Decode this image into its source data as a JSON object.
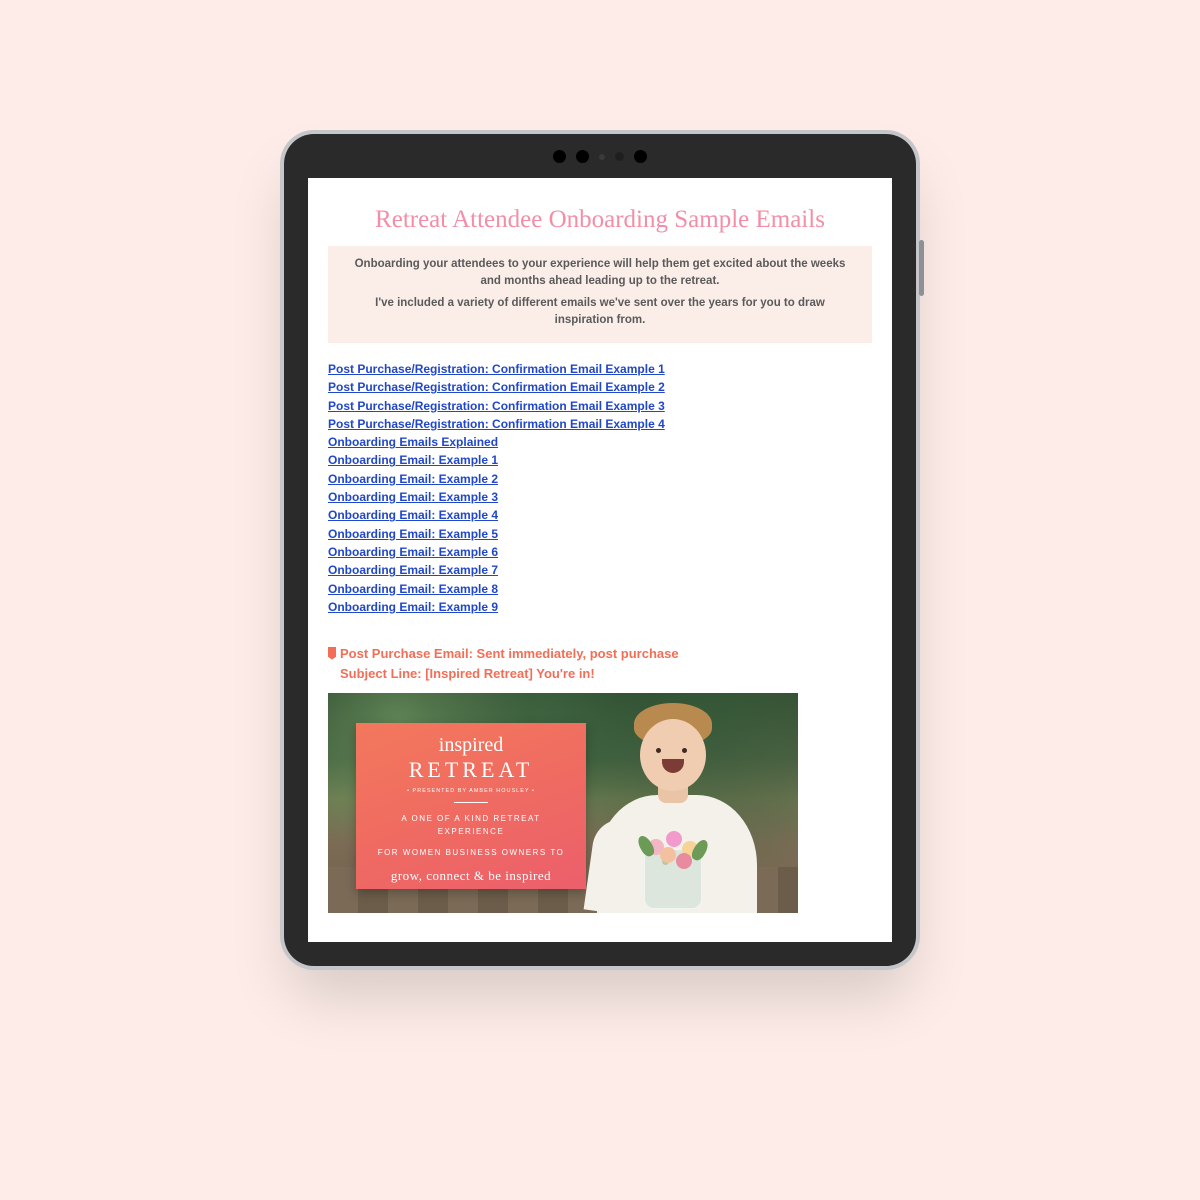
{
  "doc": {
    "title": "Retreat Attendee Onboarding Sample Emails",
    "intro_p1": "Onboarding your attendees to your experience will help them get excited about the weeks and months ahead leading up to the retreat.",
    "intro_p2": "I've included a variety of different emails we've sent over the years for you to draw inspiration from.",
    "toc": [
      "Post Purchase/Registration: Confirmation Email Example 1",
      "Post Purchase/Registration: Confirmation Email Example 2",
      "Post Purchase/Registration: Confirmation Email Example 3",
      "Post Purchase/Registration: Confirmation Email Example 4",
      "Onboarding Emails Explained",
      "Onboarding Email: Example 1",
      "Onboarding Email: Example 2",
      "Onboarding Email: Example 3",
      "Onboarding Email: Example 4",
      "Onboarding Email: Example 5",
      "Onboarding Email: Example 6",
      "Onboarding Email: Example 7",
      "Onboarding Email: Example 8",
      "Onboarding Email: Example 9"
    ],
    "section_heading": "Post Purchase Email: Sent immediately, post purchase",
    "subject_line": "Subject Line: [Inspired Retreat] You're in!"
  },
  "hero": {
    "script": "inspired",
    "retreat": "RETREAT",
    "presented": "• PRESENTED BY AMBER HOUSLEY •",
    "tag1": "A ONE OF A KIND RETREAT EXPERIENCE",
    "tag2": "FOR WOMEN BUSINESS OWNERS TO",
    "tag3": "grow, connect & be inspired"
  }
}
